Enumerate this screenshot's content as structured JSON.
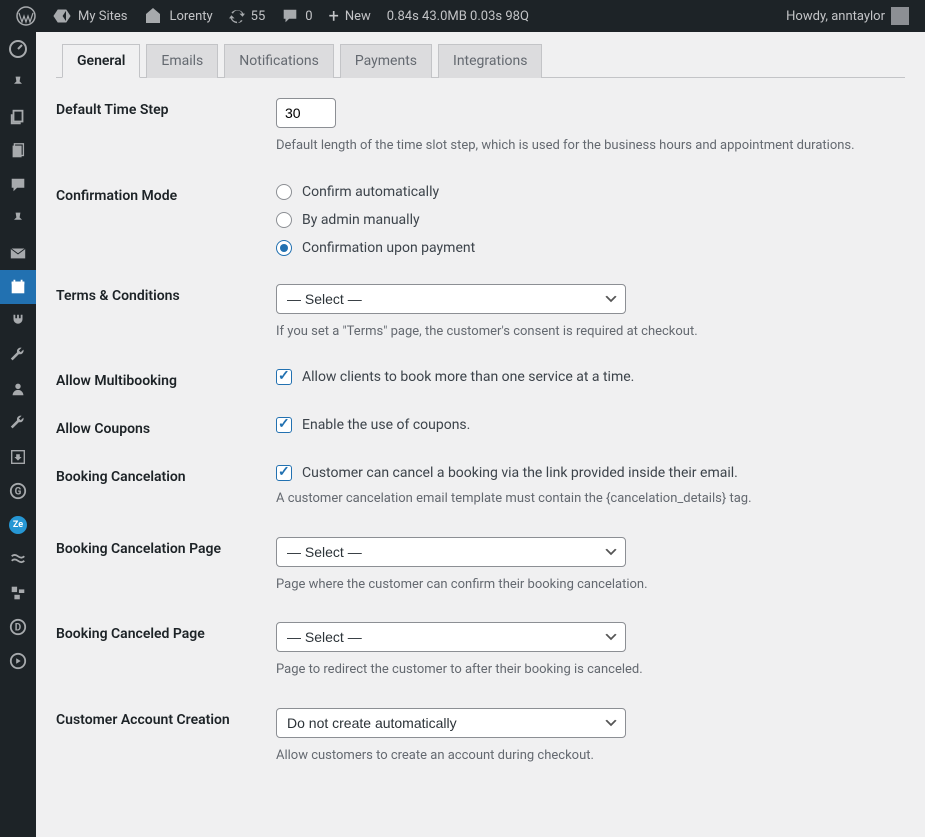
{
  "adminbar": {
    "my_sites": "My Sites",
    "site_name": "Lorenty",
    "updates": "55",
    "comments": "0",
    "new": "New",
    "stats": "0.84s  43.0MB  0.03s  98Q",
    "howdy": "Howdy, anntaylor"
  },
  "tabs": [
    {
      "label": "General",
      "active": true
    },
    {
      "label": "Emails",
      "active": false
    },
    {
      "label": "Notifications",
      "active": false
    },
    {
      "label": "Payments",
      "active": false
    },
    {
      "label": "Integrations",
      "active": false
    }
  ],
  "fields": {
    "default_time_step": {
      "label": "Default Time Step",
      "value": "30",
      "desc": "Default length of the time slot step, which is used for the business hours and appointment durations."
    },
    "confirmation_mode": {
      "label": "Confirmation Mode",
      "options": {
        "auto": "Confirm automatically",
        "admin": "By admin manually",
        "payment": "Confirmation upon payment"
      },
      "selected": "payment"
    },
    "terms": {
      "label": "Terms & Conditions",
      "select": "— Select —",
      "desc": "If you set a \"Terms\" page, the customer's consent is required at checkout."
    },
    "multibooking": {
      "label": "Allow Multibooking",
      "check_label": "Allow clients to book more than one service at a time."
    },
    "coupons": {
      "label": "Allow Coupons",
      "check_label": "Enable the use of coupons."
    },
    "cancelation": {
      "label": "Booking Cancelation",
      "check_label": "Customer can cancel a booking via the link provided inside their email.",
      "desc": "A customer cancelation email template must contain the {cancelation_details} tag."
    },
    "cancel_page": {
      "label": "Booking Cancelation Page",
      "select": "— Select —",
      "desc": "Page where the customer can confirm their booking cancelation."
    },
    "canceled_page": {
      "label": "Booking Canceled Page",
      "select": "— Select —",
      "desc": "Page to redirect the customer to after their booking is canceled."
    },
    "account_creation": {
      "label": "Customer Account Creation",
      "select": "Do not create automatically",
      "desc": "Allow customers to create an account during checkout."
    }
  }
}
